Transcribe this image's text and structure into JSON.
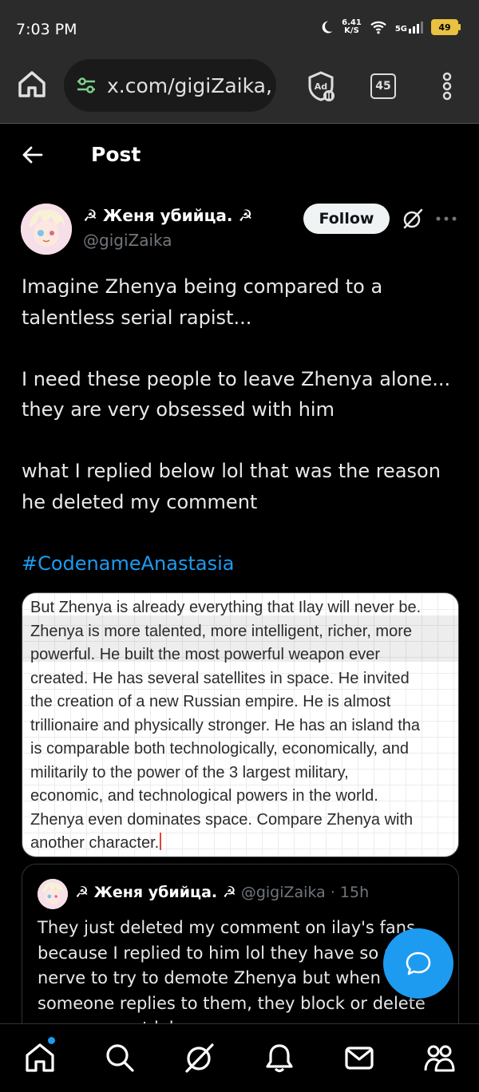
{
  "status_bar": {
    "time": "7:03 PM",
    "net_speed": "6.41",
    "net_unit": "K/S",
    "network": "5G",
    "battery": "49"
  },
  "browser": {
    "url": "x.com/gigiZaika,",
    "tab_count": "45"
  },
  "header": {
    "title": "Post"
  },
  "author": {
    "display_name": "☭ Женя убийца. ☭",
    "handle": "@gigiZaika",
    "follow_label": "Follow"
  },
  "post": {
    "lines": [
      "Imagine Zhenya being compared to a",
      "talentless serial rapist...",
      "I need these people to leave Zhenya alone...",
      "they are very obsessed with him",
      "what I replied below lol that was the reason",
      "he deleted my comment"
    ],
    "hashtag": "#CodenameAnastasia"
  },
  "media": {
    "lines": [
      "But Zhenya is already everything that Ilay will never be.",
      "Zhenya is more talented, more intelligent, richer, more",
      "powerful. He built the most powerful weapon ever",
      "created. He has several satellites in space. He invited",
      "the creation of a new Russian empire. He is almost",
      "trillionaire and physically stronger. He has an island tha",
      "is comparable both technologically, economically, and",
      "militarily to the power of the 3 largest military,",
      "economic, and technological powers in the world.",
      "Zhenya even dominates space. Compare Zhenya with",
      "another character."
    ]
  },
  "quote": {
    "display_name": "☭ Женя убийца. ☭",
    "handle": "@gigiZaika",
    "separator": " · ",
    "time": "15h",
    "lines": [
      "They just deleted my comment on ilay's fans",
      "because I replied to him lol they have so m",
      "nerve to try to demote Zhenya but when",
      "someone replies to them, they block or delete",
      "my comment lol"
    ]
  },
  "colors": {
    "accent": "#1d9bf0",
    "background": "#000000",
    "text": "#e7e9ea",
    "muted": "#71767b"
  },
  "icons": {
    "browser": [
      "home-icon",
      "tune-icon",
      "ad-block-icon",
      "tabs-icon",
      "kebab-menu-icon"
    ],
    "post": [
      "back-arrow-icon",
      "grok-icon",
      "more-icon"
    ],
    "nav": [
      "home-icon",
      "search-icon",
      "grok-icon",
      "notifications-icon",
      "messages-icon",
      "communities-icon"
    ],
    "fab": "chat-bubble-icon"
  }
}
